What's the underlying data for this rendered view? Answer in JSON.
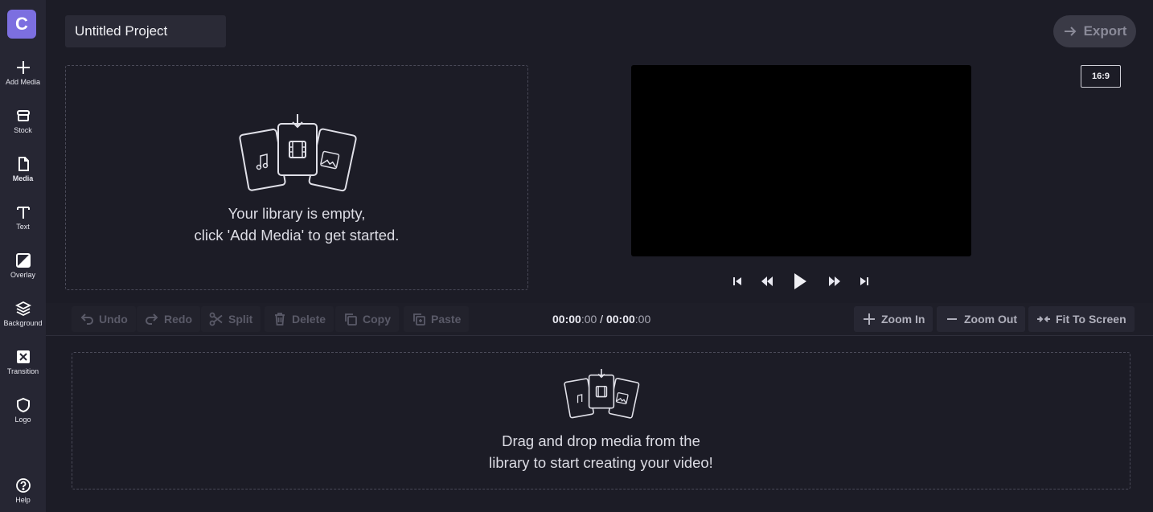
{
  "brand": {
    "logo_letter": "C",
    "accent": "#7c6fe0"
  },
  "sidebar": {
    "items": [
      {
        "label": "Add Media",
        "icon": "plus-icon"
      },
      {
        "label": "Stock",
        "icon": "stock-icon"
      },
      {
        "label": "Media",
        "icon": "file-icon"
      },
      {
        "label": "Text",
        "icon": "text-icon"
      },
      {
        "label": "Overlay",
        "icon": "overlay-icon"
      },
      {
        "label": "Background",
        "icon": "layers-icon"
      },
      {
        "label": "Transition",
        "icon": "transition-icon"
      },
      {
        "label": "Logo",
        "icon": "shield-icon"
      }
    ],
    "help": {
      "label": "Help",
      "icon": "help-icon"
    }
  },
  "header": {
    "project_title": "Untitled Project",
    "export_label": "Export"
  },
  "library": {
    "line1": "Your library is empty,",
    "line2": "click 'Add Media' to get started."
  },
  "preview": {
    "aspect_ratio": "16:9"
  },
  "toolbar": {
    "undo": "Undo",
    "redo": "Redo",
    "split": "Split",
    "delete": "Delete",
    "copy": "Copy",
    "paste": "Paste",
    "zoom_in": "Zoom In",
    "zoom_out": "Zoom Out",
    "fit": "Fit To Screen"
  },
  "timecode": {
    "current_main": "00:00",
    "current_frac": ":00",
    "separator": " / ",
    "total_main": "00:00",
    "total_frac": ":00"
  },
  "timeline": {
    "line1": "Drag and drop media from the",
    "line2": "library to start creating your video!"
  }
}
